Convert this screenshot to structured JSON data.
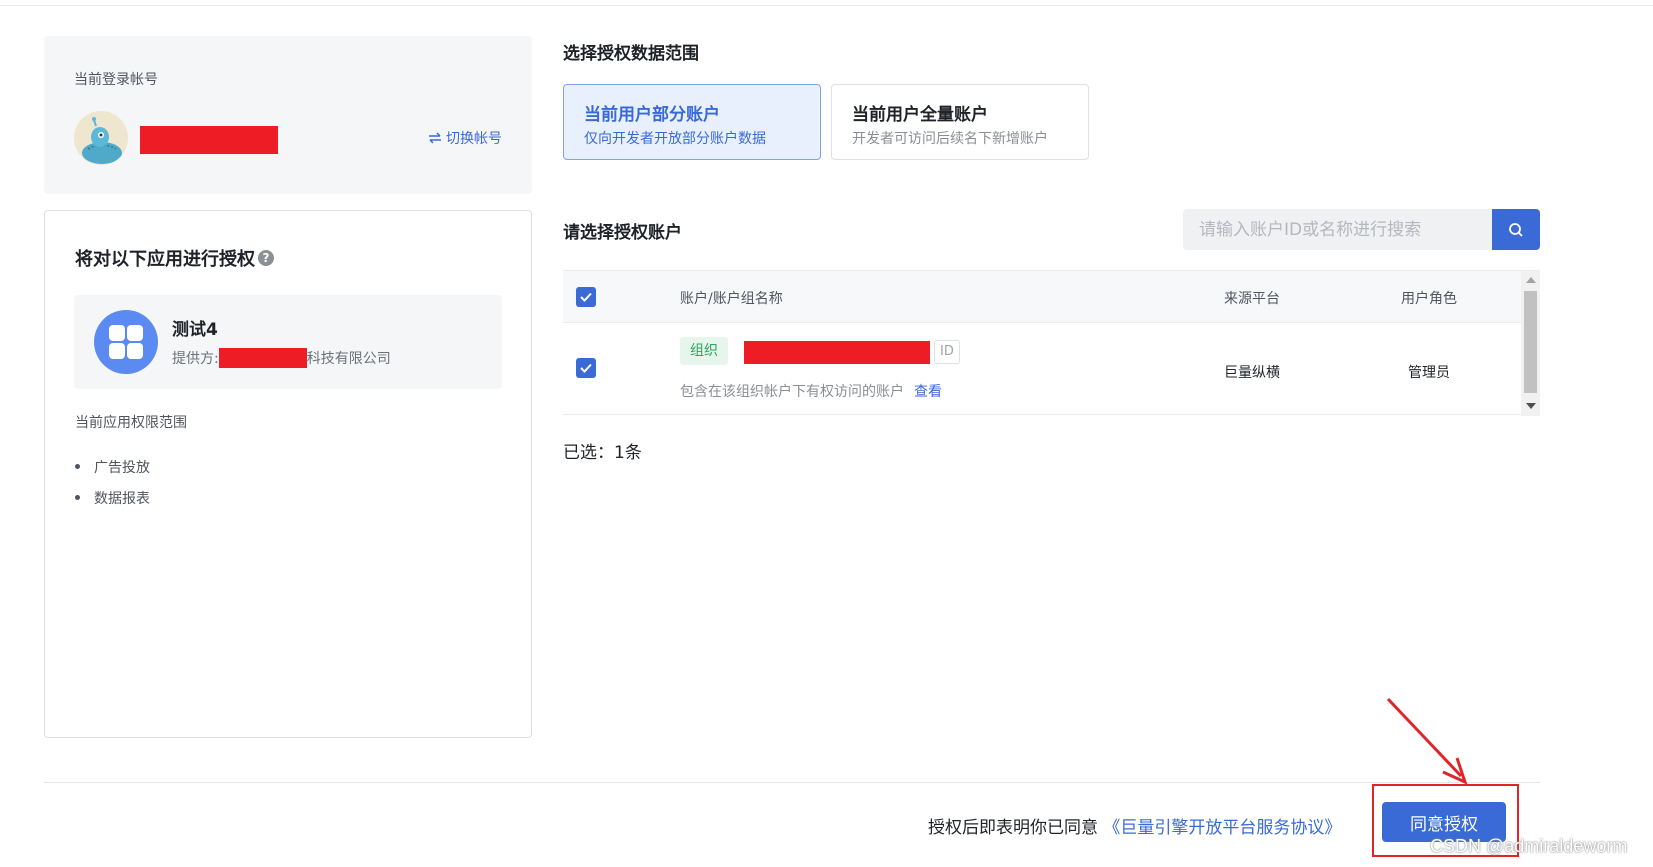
{
  "account": {
    "label": "当前登录帐号",
    "switch_label": "切换帐号"
  },
  "app": {
    "section_title": "将对以下应用进行授权",
    "name": "测试4",
    "provider_prefix": "提供方:",
    "provider_suffix": "科技有限公司",
    "scope_label": "当前应用权限范围",
    "scopes": [
      "广告投放",
      "数据报表"
    ]
  },
  "range": {
    "title": "选择授权数据范围",
    "options": [
      {
        "title": "当前用户部分账户",
        "desc": "仅向开发者开放部分账户数据",
        "selected": true
      },
      {
        "title": "当前用户全量账户",
        "desc": "开发者可访问后续名下新增账户",
        "selected": false
      }
    ]
  },
  "accounts": {
    "title": "请选择授权账户",
    "search_placeholder": "请输入账户ID或名称进行搜索",
    "columns": [
      "账户/账户组名称",
      "来源平台",
      "用户角色"
    ],
    "rows": [
      {
        "tag": "组织",
        "id_label": "ID",
        "desc": "包含在该组织帐户下有权访问的账户",
        "view_label": "查看",
        "platform": "巨量纵横",
        "role": "管理员",
        "checked": true
      }
    ],
    "selected_count": "已选：1条"
  },
  "footer": {
    "agree_text": "授权后即表明你已同意",
    "agreement_link": "《巨量引擎开放平台服务协议》",
    "agree_button": "同意授权"
  },
  "watermark": "CSDN @admiraldeworm",
  "colors": {
    "primary": "#3a6ad6",
    "redaction": "#ee1c25",
    "tag_green": "#2ea35b",
    "annotation_red": "#e1242a"
  }
}
